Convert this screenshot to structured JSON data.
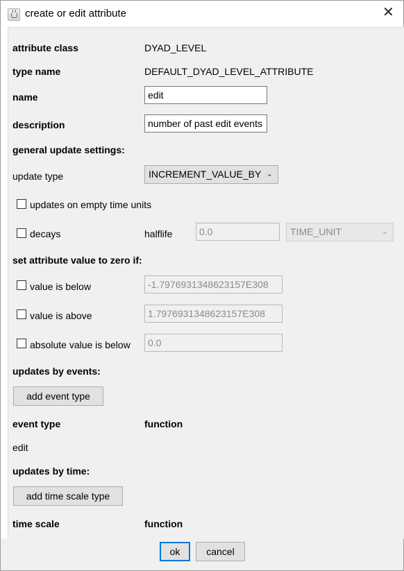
{
  "window": {
    "title": "create or edit attribute"
  },
  "attribute_class": {
    "label": "attribute class",
    "value": "DYAD_LEVEL"
  },
  "type_name": {
    "label": "type name",
    "value": "DEFAULT_DYAD_LEVEL_ATTRIBUTE"
  },
  "name": {
    "label": "name",
    "value": "edit"
  },
  "description": {
    "label": "description",
    "value": "number of past edit events"
  },
  "general_update": {
    "heading": "general update settings:",
    "update_type_label": "update type",
    "update_type_value": "INCREMENT_VALUE_BY",
    "empty_units_label": "updates on empty time units",
    "decays_label": "decays",
    "halflife_label": "halflife",
    "halflife_value": "0.0",
    "time_unit_value": "TIME_UNIT"
  },
  "zero_settings": {
    "heading": "set attribute value to zero if:",
    "below_label": "value is below",
    "below_value": "-1.7976931348623157E308",
    "above_label": "value is above",
    "above_value": "1.7976931348623157E308",
    "abs_below_label": "absolute value is below",
    "abs_below_value": "0.0"
  },
  "events": {
    "heading": "updates by events:",
    "add_button": "add event type",
    "col_event_type": "event type",
    "col_function": "function",
    "rows": [
      "edit"
    ]
  },
  "time": {
    "heading": "updates by time:",
    "add_button": "add time scale type",
    "col_time_scale": "time scale",
    "col_function": "function"
  },
  "footer": {
    "ok_label": "ok",
    "cancel_label": "cancel"
  }
}
